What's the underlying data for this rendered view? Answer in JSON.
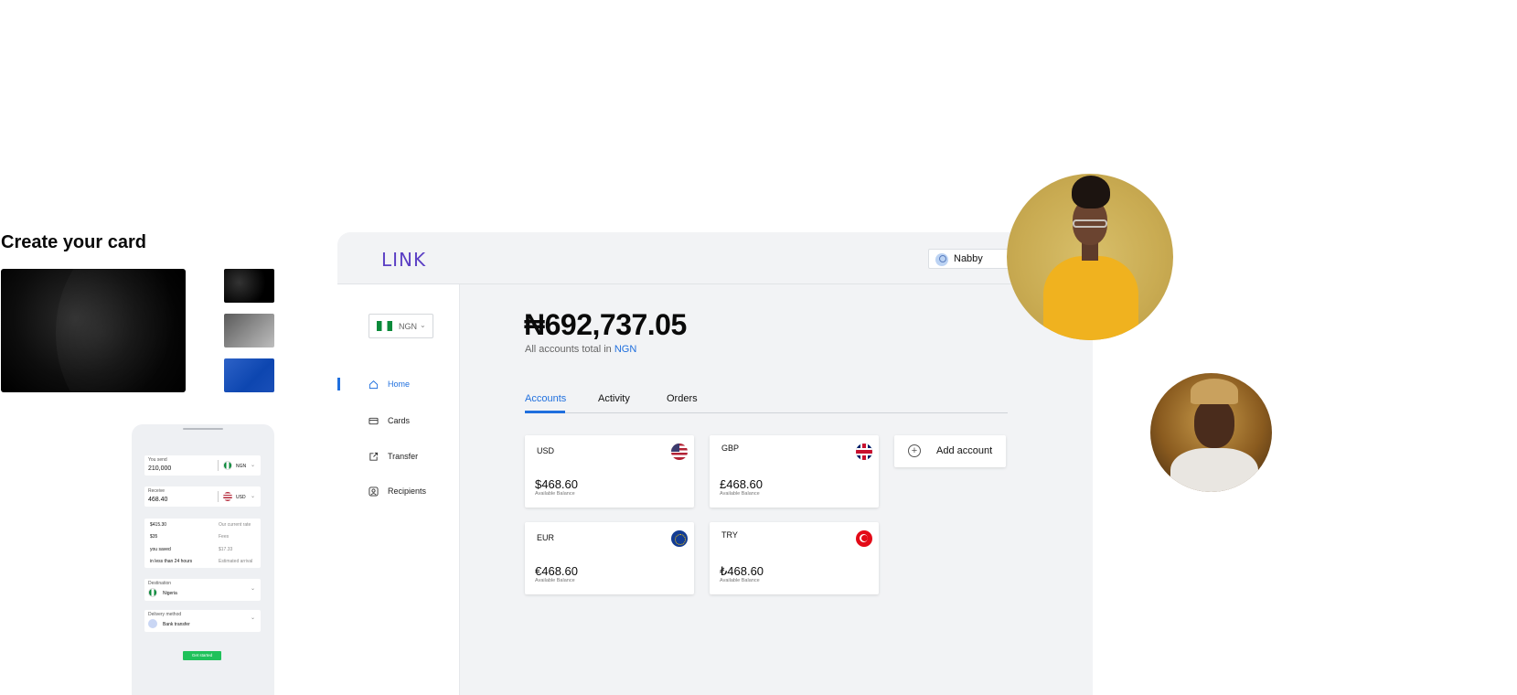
{
  "create_card": {
    "title": "Create your card"
  },
  "phone": {
    "you_send_label": "You send",
    "you_send_value": "210,000",
    "you_send_currency": "NGN",
    "receive_label": "Receive",
    "receive_value": "468.40",
    "receive_currency": "USD",
    "rates": [
      {
        "left": "$415.30",
        "right": "Our current rate"
      },
      {
        "left": "$35",
        "right": "Fees"
      },
      {
        "left": "you saved",
        "right": "$17.33"
      },
      {
        "left": "in less than 24 hours",
        "right": "Estimated arrival"
      }
    ],
    "destination_label": "Destination",
    "destination_value": "Nigeria",
    "delivery_label": "Delivery method",
    "delivery_value": "Bank transfer",
    "cta": "Get started"
  },
  "dashboard": {
    "logo": "LINK",
    "user_name": "Nabby",
    "currency_selector": "NGN",
    "nav": [
      {
        "label": "Home",
        "icon": "home-icon",
        "active": true
      },
      {
        "label": "Cards",
        "icon": "card-icon",
        "active": false
      },
      {
        "label": "Transfer",
        "icon": "transfer-icon",
        "active": false
      },
      {
        "label": "Recipients",
        "icon": "recipients-icon",
        "active": false
      }
    ],
    "balance": "₦692,737.05",
    "balance_sub_prefix": "All accounts total in ",
    "balance_sub_currency": "NGN",
    "tabs": [
      "Accounts",
      "Activity",
      "Orders"
    ],
    "accounts": [
      {
        "code": "USD",
        "amount": "$468.60",
        "sub": "Available Balance",
        "flag": "us-flag-icon"
      },
      {
        "code": "GBP",
        "amount": "£468.60",
        "sub": "Available Balance",
        "flag": "uk-flag-icon"
      },
      {
        "code": "EUR",
        "amount": "€468.60",
        "sub": "Available Balance",
        "flag": "eu-flag-icon"
      },
      {
        "code": "TRY",
        "amount": "₺468.60",
        "sub": "Available Balance",
        "flag": "turkey-flag-icon"
      }
    ],
    "add_account": "Add account"
  },
  "colors": {
    "accent": "#1f6fde",
    "logo": "#5b3fc4",
    "cta_green": "#1fc15a"
  }
}
